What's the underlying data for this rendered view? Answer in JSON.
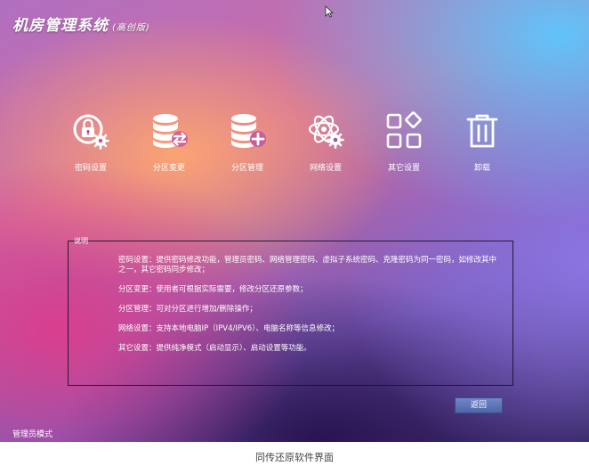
{
  "app": {
    "title": "机房管理系统",
    "edition": "(高创版)"
  },
  "toolbar": {
    "items": [
      {
        "label": "密码设置",
        "icon": "lock-gear-icon"
      },
      {
        "label": "分区变更",
        "icon": "database-swap-icon"
      },
      {
        "label": "分区管理",
        "icon": "database-plus-icon"
      },
      {
        "label": "网络设置",
        "icon": "network-gear-icon"
      },
      {
        "label": "其它设置",
        "icon": "apps-grid-icon"
      },
      {
        "label": "卸载",
        "icon": "trash-icon"
      }
    ]
  },
  "description": {
    "legend": "说明",
    "lines": [
      "密码设置：提供密码修改功能，管理员密码、网络管理密码、虚拟子系统密码、克隆密码为同一密码，如修改其中之一，其它密码同步修改；",
      "分区变更：使用者可根据实际需要，修改分区还原参数；",
      "分区管理：可对分区进行增加/删除操作；",
      "网络设置：支持本地电脑IP（IPV4/IPV6）、电脑名称等信息修改；",
      "其它设置：提供纯净模式（启动显示）、启动设置等功能。"
    ]
  },
  "back_button": "返回",
  "status": {
    "mode": "管理员模式"
  },
  "caption": "同传还原软件界面"
}
